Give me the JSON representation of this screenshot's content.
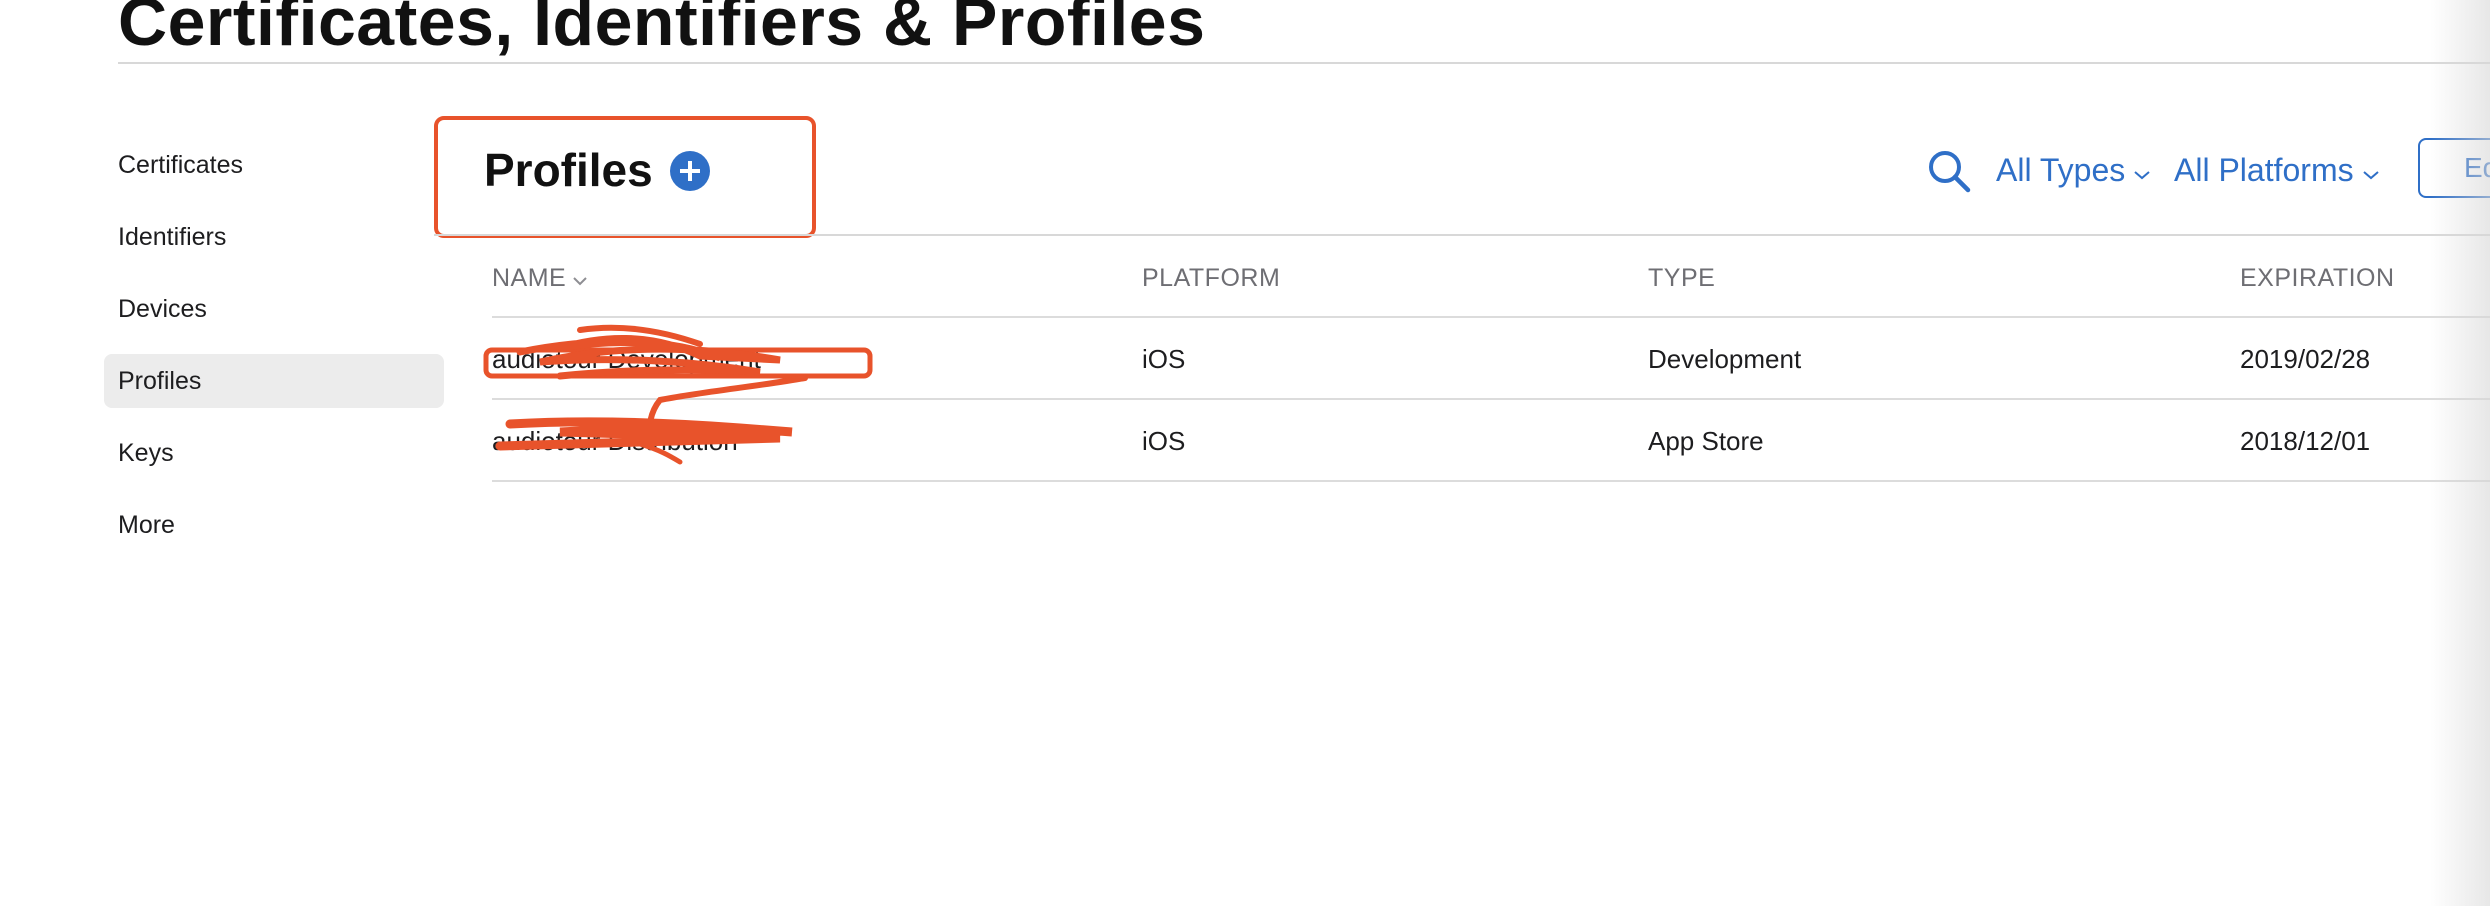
{
  "header": {
    "title": "Certificates, Identifiers & Profiles"
  },
  "sidebar": {
    "items": [
      {
        "label": "Certificates",
        "active": false
      },
      {
        "label": "Identifiers",
        "active": false
      },
      {
        "label": "Devices",
        "active": false
      },
      {
        "label": "Profiles",
        "active": true
      },
      {
        "label": "Keys",
        "active": false
      },
      {
        "label": "More",
        "active": false
      }
    ]
  },
  "section": {
    "title": "Profiles",
    "add_icon": "plus-circle-icon"
  },
  "toolbar": {
    "search_icon": "search-icon",
    "filter_types": "All Types",
    "filter_platforms": "All Platforms",
    "edit_label": "Edit"
  },
  "table": {
    "columns": [
      "NAME",
      "PLATFORM",
      "TYPE",
      "EXPIRATION"
    ],
    "rows": [
      {
        "name": "audiotour Development",
        "platform": "iOS",
        "type": "Development",
        "expiration": "2019/02/28"
      },
      {
        "name": "audiotour Distribution",
        "platform": "iOS",
        "type": "App Store",
        "expiration": "2018/12/01"
      }
    ]
  },
  "colors": {
    "accent": "#2f6fc7",
    "annotation": "#e8532b",
    "sidebar_active_bg": "#ececec"
  }
}
